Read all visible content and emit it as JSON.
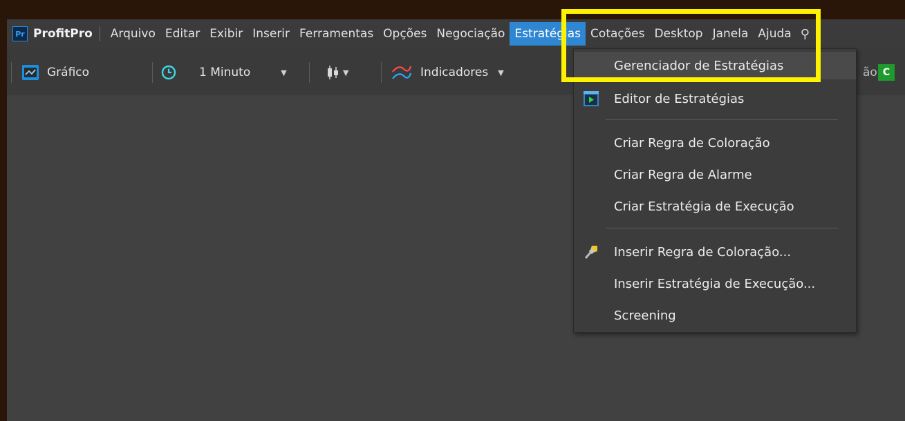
{
  "app": {
    "logo_text": "Pr",
    "name": "ProfitPro"
  },
  "menu": [
    {
      "label": "Arquivo"
    },
    {
      "label": "Editar"
    },
    {
      "label": "Exibir"
    },
    {
      "label": "Inserir"
    },
    {
      "label": "Ferramentas"
    },
    {
      "label": "Opções"
    },
    {
      "label": "Negociação"
    },
    {
      "label": "Estratégias",
      "active": true
    },
    {
      "label": "Cotações"
    },
    {
      "label": "Desktop"
    },
    {
      "label": "Janela"
    },
    {
      "label": "Ajuda"
    }
  ],
  "toolbar": {
    "chart_label": "Gráfico",
    "interval_label": "1 Minuto",
    "indicators_label": "Indicadores",
    "partial_label": "ão",
    "tag_label": "C"
  },
  "dropdown": {
    "items": [
      {
        "label": "Gerenciador de Estratégias"
      },
      {
        "label": "Editor de Estratégias",
        "icon": "play-icon"
      },
      {
        "label": "Criar Regra de Coloração"
      },
      {
        "label": "Criar Regra de Alarme"
      },
      {
        "label": "Criar Estratégia de Execução"
      },
      {
        "label": "Inserir Regra de Coloração...",
        "icon": "paintbrush-icon"
      },
      {
        "label": "Inserir Estratégia de Execução..."
      },
      {
        "label": "Screening"
      }
    ]
  },
  "colors": {
    "accent": "#2f86d2",
    "highlight_box": "#fff200",
    "frame_bg": "#2a1608",
    "workspace_bg": "#414141"
  }
}
